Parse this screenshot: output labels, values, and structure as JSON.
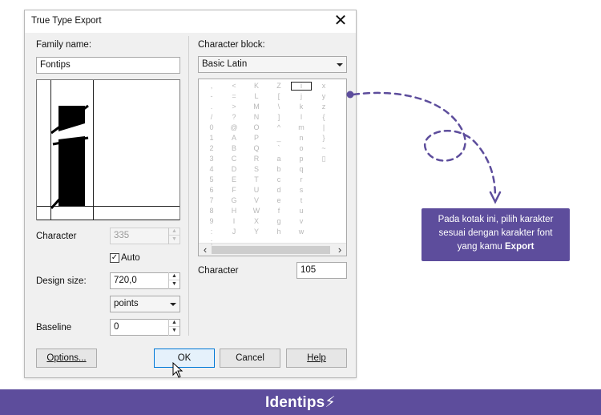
{
  "dialog": {
    "title": "True Type Export",
    "close_glyph": "✕",
    "family_label": "Family name:",
    "family_value": "Fontips",
    "character_label": "Character",
    "character_value": "335",
    "auto_label": "Auto",
    "auto_checked": true,
    "design_size_label": "Design size:",
    "design_size_value": "720,0",
    "units_value": "points",
    "baseline_label": "Baseline",
    "baseline_value": "0",
    "char_block_label": "Character block:",
    "char_block_value": "Basic Latin",
    "char_right_label": "Character",
    "char_right_value": "105",
    "buttons": {
      "options": "Options...",
      "ok": "OK",
      "cancel": "Cancel",
      "help": "Help"
    }
  },
  "charmap": {
    "columns": [
      [
        ",",
        "-",
        ".",
        "/",
        "0",
        "1",
        "2",
        "3",
        "4",
        "5",
        "6",
        "7",
        "8",
        "9",
        ":",
        ";"
      ],
      [
        "<",
        "=",
        ">",
        "?",
        "@",
        "A",
        "B",
        "C",
        "D",
        "E",
        "F",
        "G",
        "H",
        "I",
        "J"
      ],
      [
        "K",
        "L",
        "M",
        "N",
        "O",
        "P",
        "Q",
        "R",
        "S",
        "T",
        "U",
        "V",
        "W",
        "X",
        "Y"
      ],
      [
        "Z",
        "[",
        "\\",
        "]",
        "^",
        "_",
        "`",
        "a",
        "b",
        "c",
        "d",
        "e",
        "f",
        "g",
        "h"
      ],
      [
        "i",
        "j",
        "k",
        "l",
        "m",
        "n",
        "o",
        "p",
        "q",
        "r",
        "s",
        "t",
        "u",
        "v",
        "w"
      ],
      [
        "x",
        "y",
        "z",
        "{",
        "|",
        "}",
        "~",
        "▯"
      ]
    ],
    "selected": "i"
  },
  "annotation": {
    "line1": "Pada kotak ini, pilih karakter",
    "line2": "sesuai dengan karakter font",
    "line3_prefix": "yang kamu ",
    "line3_bold": "Export",
    "color": "#5d4d9c"
  },
  "footer": {
    "brand": "Identips⚡"
  }
}
